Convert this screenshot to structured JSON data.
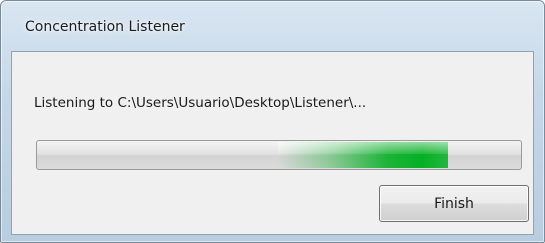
{
  "window": {
    "title": "Concentration Listener"
  },
  "dialog": {
    "status_text": "Listening to C:\\Users\\Usuario\\Desktop\\Listener\\...",
    "finish_label": "Finish"
  },
  "progress": {
    "style": "marquee-indeterminate",
    "indicator_color": "#06b025",
    "indicator_position_fraction": 0.85
  },
  "colors": {
    "title_bar": "#c5d7e8",
    "client_background": "#f0f0f0"
  }
}
